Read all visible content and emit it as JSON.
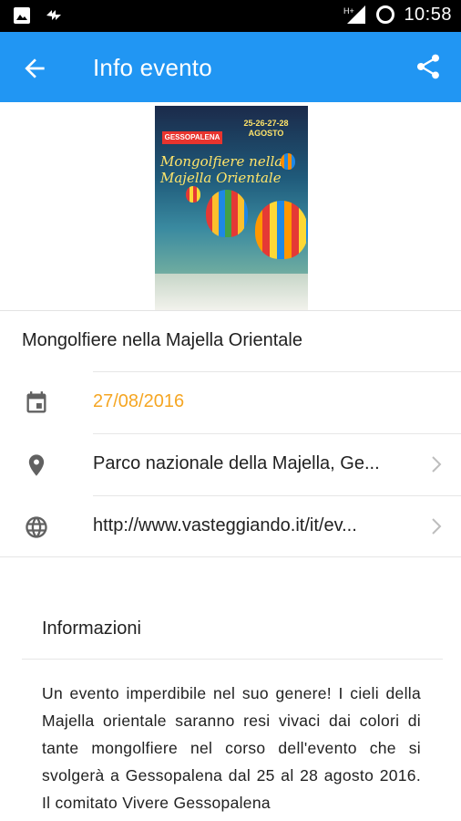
{
  "status_bar": {
    "time": "10:58",
    "left_icons": [
      "image-notification-icon",
      "sync-notification-icon"
    ],
    "right_icons": [
      "hplus-signal-icon",
      "battery-ring-icon"
    ]
  },
  "app_bar": {
    "title": "Info evento",
    "back_icon": "arrow-back-icon",
    "share_icon": "share-icon",
    "background_color": "#2196f3"
  },
  "poster": {
    "banner": "GESSOPALENA",
    "dates": "25-26-27-28 AGOSTO",
    "script_title": "Mongolfiere nella Majella Orientale"
  },
  "event": {
    "title": "Mongolfiere nella Majella Orientale",
    "date": "27/08/2016",
    "date_color": "#f5a623",
    "location": "Parco nazionale della Majella, Ge...",
    "url": "http://www.vasteggiando.it/it/ev..."
  },
  "info": {
    "heading": "Informazioni",
    "body": "Un evento imperdibile nel suo genere! I cieli della Majella orientale saranno resi vivaci dai colori di tante mongolfiere nel corso dell'evento che si svolgerà a Gessopalena dal 25 al 28 agosto 2016. Il comitato Vivere Gessopalena"
  }
}
